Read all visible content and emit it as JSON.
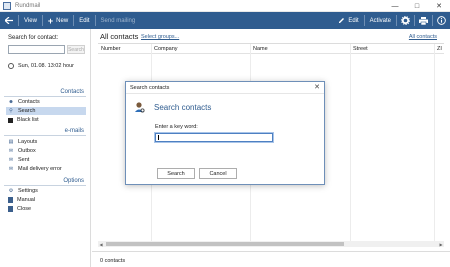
{
  "window": {
    "title": "Rundmail",
    "controls": [
      "minimize-icon",
      "maximize-icon",
      "close-icon"
    ]
  },
  "toolbar": {
    "view_label": "View",
    "new_label": "New",
    "edit_label": "Edit",
    "send_mailing_label": "Send mailing",
    "edit_right_label": "Edit",
    "activate_label": "Activate",
    "icons": [
      "back-icon",
      "plus-icon",
      "pencil-icon",
      "gear-icon",
      "printer-icon",
      "info-icon"
    ]
  },
  "sidebar": {
    "search_label": "Search for contact:",
    "search_input_value": "",
    "search_button_label": "Search",
    "date_text": "Sun, 01.08.  13:02 hour",
    "contacts_header": "Contacts",
    "contacts_items": [
      {
        "label": "Contacts",
        "icon": "contacts-icon"
      },
      {
        "label": "Search",
        "icon": "search-icon",
        "active": true
      },
      {
        "label": "Black list",
        "icon": "blacklist-icon"
      }
    ],
    "emails_header": "e-mails",
    "emails_items": [
      {
        "label": "Layouts",
        "icon": "layouts-icon"
      },
      {
        "label": "Outbox",
        "icon": "outbox-icon"
      },
      {
        "label": "Sent",
        "icon": "sent-icon"
      },
      {
        "label": "Mail delivery error",
        "icon": "error-icon"
      }
    ],
    "options_header": "Options",
    "options_items": [
      {
        "label": "Settings",
        "icon": "gear-icon"
      },
      {
        "label": "Manual",
        "icon": "manual-icon"
      },
      {
        "label": "Close",
        "icon": "close-icon"
      }
    ]
  },
  "main": {
    "title": "All contacts",
    "select_groups_label": "Select groups...",
    "all_contacts_link": "All contacts",
    "columns": [
      "Number",
      "Company",
      "Name",
      "Street",
      "ZI"
    ],
    "status_text": "0 contacts"
  },
  "dialog": {
    "title": "Search contacts",
    "heading": "Search contacts",
    "prompt_label": "Enter a key word:",
    "input_value": "",
    "search_button": "Search",
    "cancel_button": "Cancel"
  },
  "colors": {
    "accent": "#2f5c8f",
    "selection": "#c7d8ee"
  }
}
